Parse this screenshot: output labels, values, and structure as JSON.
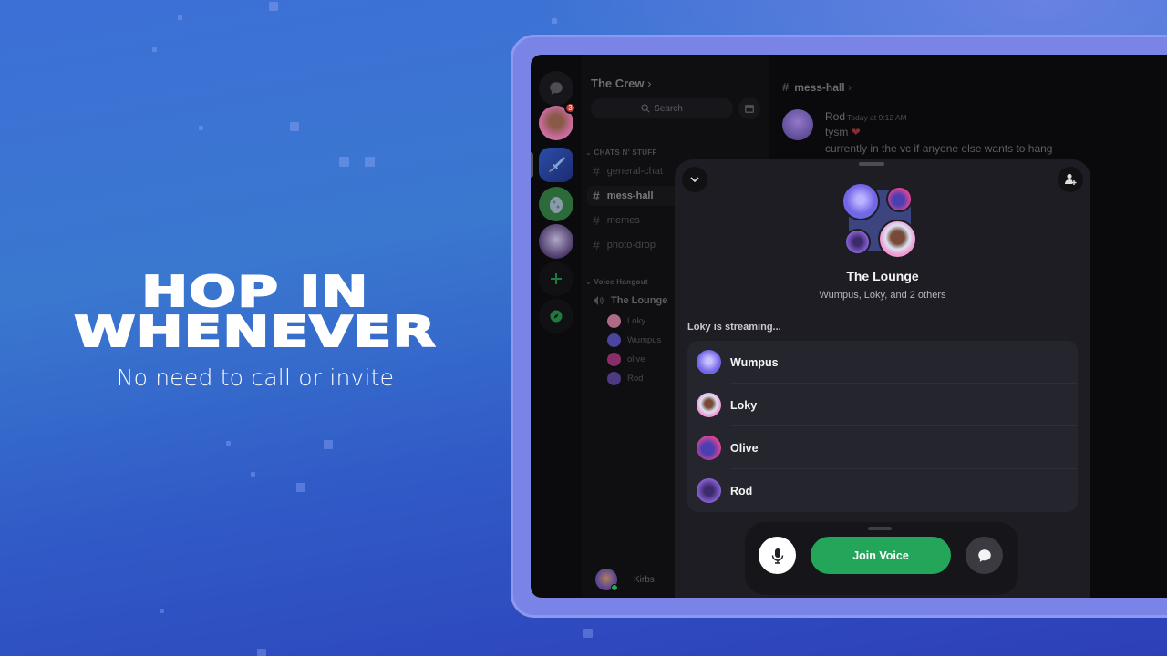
{
  "hero": {
    "headline_line1": "HOP IN",
    "headline_line2": "WHENEVER",
    "subtitle": "No need to call or invite"
  },
  "colors": {
    "background_top": "#3d6fd6",
    "background_bottom": "#2d3fb8",
    "tablet_frame": "#7a84e6",
    "join_green": "#23a55a",
    "badge_red": "#c23a3a"
  },
  "server_rail": {
    "items": [
      {
        "name": "direct-messages",
        "icon": "chat-bubble-icon"
      },
      {
        "name": "user-avatar",
        "badge": "3"
      },
      {
        "name": "server-sword"
      },
      {
        "name": "server-egg"
      },
      {
        "name": "server-anime"
      },
      {
        "name": "add-server",
        "icon": "plus-icon"
      },
      {
        "name": "discover",
        "icon": "compass-icon"
      }
    ]
  },
  "channels": {
    "server_name": "The Crew",
    "search_placeholder": "Search",
    "categories": [
      {
        "label": "CHATS N' STUFF",
        "channels": [
          {
            "name": "general-chat",
            "active": false
          },
          {
            "name": "mess-hall",
            "active": true
          },
          {
            "name": "memes",
            "active": false
          },
          {
            "name": "photo-drop",
            "active": false
          }
        ]
      },
      {
        "label": "Voice Hangout",
        "voice_channel": "The Lounge",
        "users": [
          "Loky",
          "Wumpus",
          "olive",
          "Rod"
        ]
      }
    ],
    "current_user": "Kirbs"
  },
  "chat": {
    "channel": "mess-hall",
    "message": {
      "author": "Rod",
      "timestamp": "Today at 9:12 AM",
      "line1": "tysm",
      "line1_emoji": "❤",
      "line2": "currently in the vc if anyone else wants to hang"
    }
  },
  "voice_sheet": {
    "title": "The Lounge",
    "subtitle": "Wumpus, Loky, and 2 others",
    "streaming_label": "Loky is streaming...",
    "participants": [
      {
        "name": "Wumpus",
        "color": "#7a6df0"
      },
      {
        "name": "Loky",
        "color": "#f39ad2"
      },
      {
        "name": "Olive",
        "color": "#e0409a"
      },
      {
        "name": "Rod",
        "color": "#8a62d8"
      }
    ],
    "join_label": "Join Voice"
  }
}
